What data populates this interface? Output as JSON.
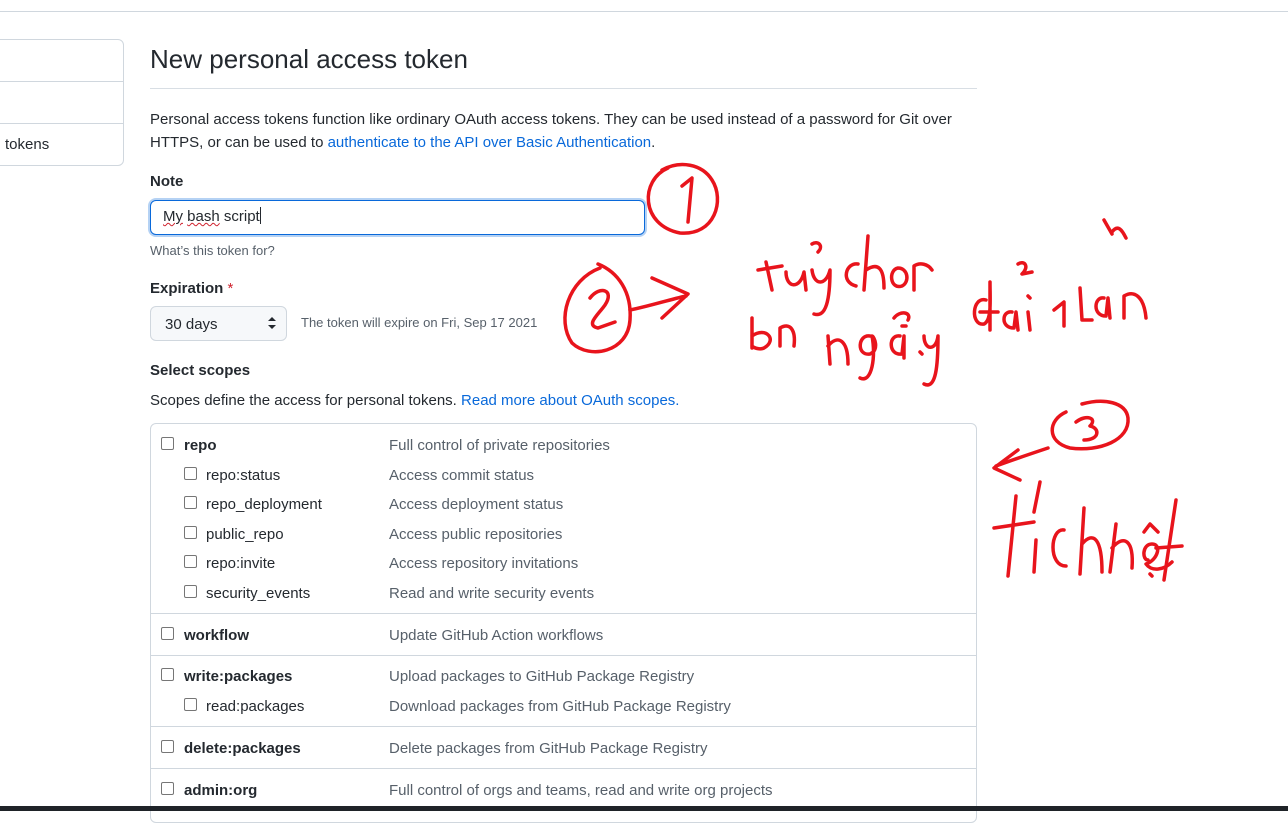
{
  "sidebar": {
    "items": [
      {
        "label": ""
      },
      {
        "label": ""
      },
      {
        "label": "tokens"
      }
    ]
  },
  "page": {
    "title": "New personal access token",
    "intro_text": "Personal access tokens function like ordinary OAuth access tokens. They can be used instead of a password for Git over HTTPS, or can be used to ",
    "intro_link": "authenticate to the API over Basic Authentication",
    "intro_end": "."
  },
  "note": {
    "label": "Note",
    "value_word1": "My",
    "value_word2": "bash",
    "value_rest": " script",
    "hint": "What’s this token for?"
  },
  "expiration": {
    "label": "Expiration",
    "required_mark": "*",
    "selected": "30 days",
    "expire_text": "The token will expire on Fri, Sep 17 2021"
  },
  "scopes": {
    "label": "Select scopes",
    "desc": "Scopes define the access for personal tokens. ",
    "desc_link": "Read more about OAuth scopes.",
    "groups": [
      {
        "name": "repo",
        "desc": "Full control of private repositories"
      },
      {
        "name": "repo:status",
        "desc": "Access commit status"
      },
      {
        "name": "repo_deployment",
        "desc": "Access deployment status"
      },
      {
        "name": "public_repo",
        "desc": "Access public repositories"
      },
      {
        "name": "repo:invite",
        "desc": "Access repository invitations"
      },
      {
        "name": "security_events",
        "desc": "Read and write security events"
      },
      {
        "name": "workflow",
        "desc": "Update GitHub Action workflows"
      },
      {
        "name": "write:packages",
        "desc": "Upload packages to GitHub Package Registry"
      },
      {
        "name": "read:packages",
        "desc": "Download packages from GitHub Package Registry"
      },
      {
        "name": "delete:packages",
        "desc": "Delete packages from GitHub Package Registry"
      },
      {
        "name": "admin:org",
        "desc": "Full control of orgs and teams, read and write org projects"
      }
    ]
  },
  "annotation": {
    "color": "#e8141c",
    "marker_1": "1",
    "marker_2": "2",
    "marker_3": "3",
    "note_2": "tuỳ chọn bn ngày đổi 1 lần",
    "note_3": "tích hết"
  }
}
